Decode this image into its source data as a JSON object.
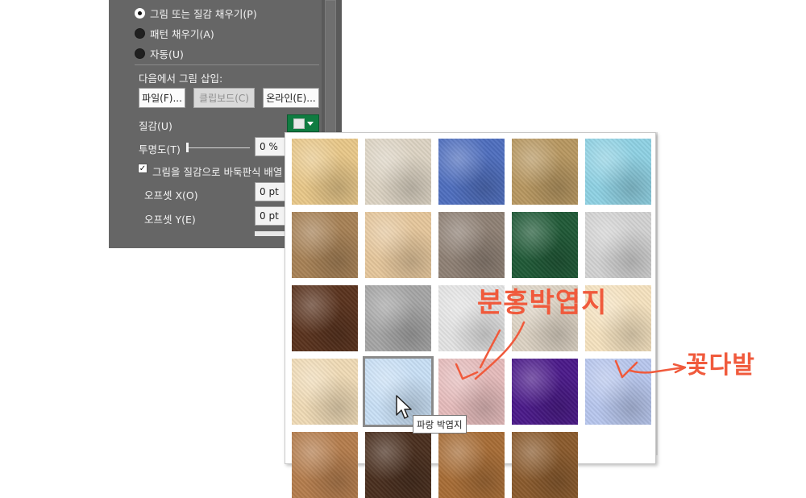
{
  "pane": {
    "fill_options": [
      {
        "label": "그림 또는 질감 채우기(P)",
        "selected": true
      },
      {
        "label": "패턴 채우기(A)",
        "selected": false
      },
      {
        "label": "자동(U)",
        "selected": false
      }
    ],
    "insert_label": "다음에서 그림 삽입:",
    "buttons": {
      "file": "파일(F)...",
      "clipboard": "클립보드(C)",
      "online": "온라인(E)..."
    },
    "texture_label": "질감(U)",
    "transparency_label": "투명도(T)",
    "transparency_value": "0 %",
    "transparency_fraction": 0,
    "tile_label": "그림을 질감으로 바둑판식 배열",
    "tile_checked": true,
    "offset_x_label": "오프셋 X(O)",
    "offset_x_value": "0 pt",
    "offset_y_label": "오프셋 Y(E)",
    "offset_y_value": "0 pt"
  },
  "gallery": {
    "tooltip": "파랑 박엽지",
    "selected_index": 16,
    "textures": [
      {
        "name": "papyrus",
        "color": "#e9c889"
      },
      {
        "name": "canvas",
        "color": "#ddd4c4"
      },
      {
        "name": "denim",
        "color": "#4f6fbf"
      },
      {
        "name": "woven-mat",
        "color": "#b89861"
      },
      {
        "name": "water-droplets",
        "color": "#8fd2e4"
      },
      {
        "name": "paper-bag",
        "color": "#a88256"
      },
      {
        "name": "fish-fossil",
        "color": "#e6c79c"
      },
      {
        "name": "sand",
        "color": "#8f8175"
      },
      {
        "name": "green-marble",
        "color": "#205a37"
      },
      {
        "name": "white-marble",
        "color": "#d3d3d3"
      },
      {
        "name": "brown-marble",
        "color": "#5a331e"
      },
      {
        "name": "granite",
        "color": "#a6a6a6"
      },
      {
        "name": "newsprint",
        "color": "#e4e4e4"
      },
      {
        "name": "recycled-paper",
        "color": "#ddd3c4"
      },
      {
        "name": "parchment",
        "color": "#f6e3c0"
      },
      {
        "name": "stationery",
        "color": "#f0dbb6"
      },
      {
        "name": "blue-tissue-paper",
        "color": "#c9e0f6"
      },
      {
        "name": "pink-tissue-paper",
        "color": "#e6bcbc"
      },
      {
        "name": "purple-mesh",
        "color": "#4b1a8a"
      },
      {
        "name": "bouquet",
        "color": "#b8c7ee"
      },
      {
        "name": "cork",
        "color": "#b57d4d"
      },
      {
        "name": "walnut",
        "color": "#4a2f1f"
      },
      {
        "name": "oak",
        "color": "#a86d36"
      },
      {
        "name": "medium-wood",
        "color": "#8b5b2d"
      }
    ]
  },
  "annotations": {
    "text1": "분홍박엽지",
    "text2": "꽃다발",
    "color": "#f05a3c"
  }
}
